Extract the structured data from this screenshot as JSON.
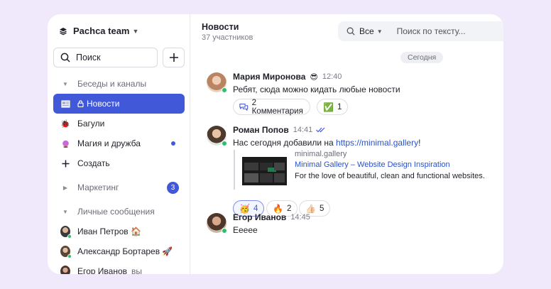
{
  "sidebar": {
    "team_name": "Pachca team",
    "search_label": "Поиск",
    "sections": {
      "chats": "Беседы и каналы",
      "marketing": "Маркетинг",
      "marketing_count": "3",
      "dms": "Личные сообщения"
    },
    "channels": [
      {
        "label": "Новости",
        "icon": "newspaper-icon",
        "active": true
      },
      {
        "label": "Багули",
        "icon": "ladybug-icon"
      },
      {
        "label": "Магия и дружба",
        "icon": "crystal-ball-icon",
        "unread": true
      }
    ],
    "create_label": "Создать",
    "dms": [
      {
        "label": "Иван Петров 🏠"
      },
      {
        "label": "Александр Бортарев 🚀"
      },
      {
        "label": "Егор Иванов",
        "suffix": "вы"
      }
    ]
  },
  "header": {
    "title": "Новости",
    "subtitle": "37 участников",
    "filter_label": "Все",
    "search_placeholder": "Поиск по тексту..."
  },
  "date_divider": "Сегодня",
  "messages": [
    {
      "author": "Мария Миронова",
      "author_emoji": "😎",
      "time": "12:40",
      "text": "Ребят, сюда можно кидать любые новости",
      "comments_label": "2 Комментария",
      "reaction": {
        "emoji": "✅",
        "count": "1"
      }
    },
    {
      "author": "Роман Попов",
      "time": "14:41",
      "text_prefix": "Нас сегодня добавили на ",
      "link": "https://minimal.gallery",
      "text_suffix": "!",
      "preview": {
        "site": "minimal.gallery",
        "title": "Minimal Gallery – Website Design Inspiration",
        "description": "For the love of beautiful, clean and functional websites."
      },
      "reactions": [
        {
          "emoji": "🥳",
          "count": "4"
        },
        {
          "emoji": "🔥",
          "count": "2"
        },
        {
          "emoji": "👍🏻",
          "count": "5"
        }
      ]
    },
    {
      "author": "Егор Иванов",
      "time": "14:45",
      "text": "Еееее"
    }
  ],
  "colors": {
    "accent": "#4158d8",
    "background": "#efe9fb",
    "online": "#2bbf6a",
    "link": "#2a52c9"
  }
}
